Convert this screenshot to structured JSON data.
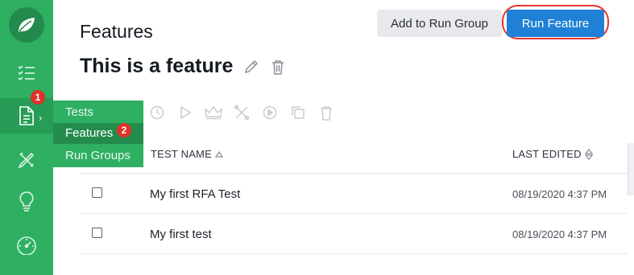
{
  "header": {
    "page_title": "Features",
    "feature_title": "This is a feature",
    "add_to_run_group_label": "Add to Run Group",
    "run_feature_label": "Run Feature"
  },
  "sidebar": {
    "items": [
      {
        "icon": "checklist-icon"
      },
      {
        "icon": "document-icon",
        "active": true
      },
      {
        "icon": "pencil-ruler-icon"
      },
      {
        "icon": "lightbulb-icon"
      },
      {
        "icon": "speedometer-icon"
      }
    ],
    "annotation_1": "1"
  },
  "flyout": {
    "items": [
      "Tests",
      "Features",
      "Run Groups"
    ],
    "selected": "Features",
    "annotation_2": "2"
  },
  "table": {
    "columns": {
      "name": "TEST NAME",
      "edited": "LAST EDITED"
    },
    "rows": [
      {
        "name": "My first RFA Test",
        "edited": "08/19/2020 4:37 PM"
      },
      {
        "name": "My first test",
        "edited": "08/19/2020 4:37 PM"
      }
    ]
  },
  "colors": {
    "sidebar": "#2eaf62",
    "primary": "#1f80d6",
    "annotation": "#e0312b"
  }
}
